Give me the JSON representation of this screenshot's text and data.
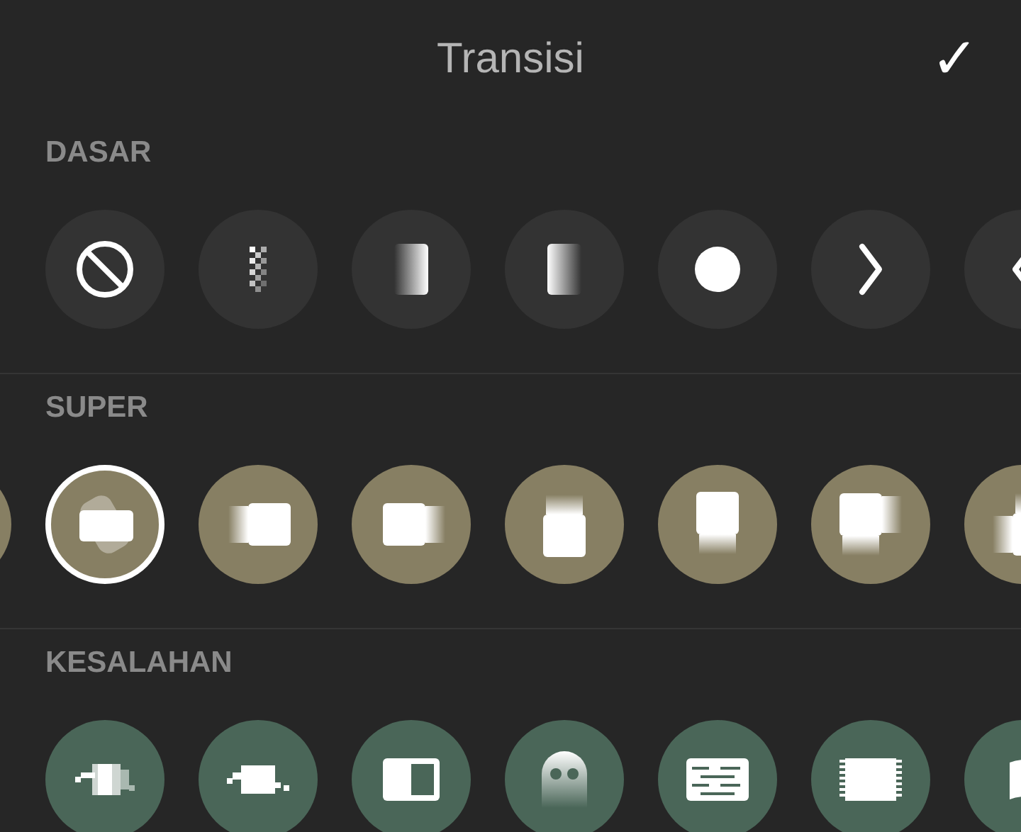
{
  "header": {
    "title": "Transisi",
    "confirm": "✓"
  },
  "sections": [
    {
      "label": "DASAR",
      "color": "#333333",
      "offset": false,
      "items": [
        {
          "kind": "none",
          "selected": false
        },
        {
          "kind": "checker",
          "selected": false
        },
        {
          "kind": "fade-left",
          "selected": false
        },
        {
          "kind": "fade-right",
          "selected": false
        },
        {
          "kind": "dot",
          "selected": false
        },
        {
          "kind": "chevron-right",
          "selected": false
        },
        {
          "kind": "chevron-left",
          "selected": false
        }
      ]
    },
    {
      "label": "SUPER",
      "color": "#877f63",
      "offset": true,
      "items": [
        {
          "selected": false
        },
        {
          "kind": "spin",
          "selected": true
        },
        {
          "kind": "slide-left",
          "selected": false
        },
        {
          "kind": "slide-right",
          "selected": false
        },
        {
          "kind": "slide-down",
          "selected": false
        },
        {
          "kind": "slide-up",
          "selected": false
        },
        {
          "kind": "slide-diag",
          "selected": false
        },
        {
          "kind": "slide-corner",
          "selected": false
        }
      ]
    },
    {
      "label": "KESALAHAN",
      "color": "#4a6658",
      "offset": false,
      "items": [
        {
          "kind": "glitch",
          "selected": false
        },
        {
          "kind": "glitch-block",
          "selected": false
        },
        {
          "kind": "panel",
          "selected": false
        },
        {
          "kind": "ghost",
          "selected": false
        },
        {
          "kind": "scramble",
          "selected": false
        },
        {
          "kind": "jitter",
          "selected": false
        },
        {
          "kind": "wave",
          "selected": false
        }
      ]
    }
  ]
}
